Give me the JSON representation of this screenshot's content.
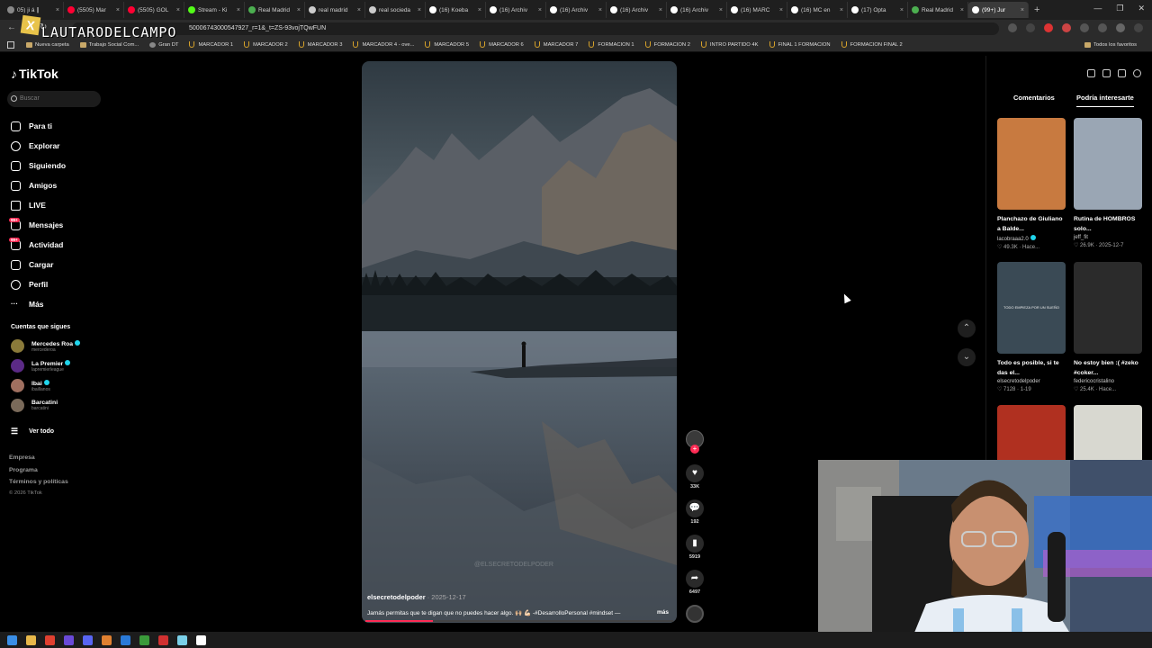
{
  "browser": {
    "tabs": [
      {
        "label": "05) ji á ∥",
        "color": "#888888"
      },
      {
        "label": "(5505) Mar",
        "color": "#ff0033"
      },
      {
        "label": "(5505) GOL",
        "color": "#ff0033"
      },
      {
        "label": "Stream - Ki",
        "color": "#53fc18"
      },
      {
        "label": "Real Madrid",
        "color": "#4caf50"
      },
      {
        "label": "real madrid",
        "color": "#cccccc"
      },
      {
        "label": "real socieda",
        "color": "#cccccc"
      },
      {
        "label": "(16) Koeba",
        "color": "#ffffff"
      },
      {
        "label": "(16) Archiv",
        "color": "#ffffff"
      },
      {
        "label": "(16) Archiv",
        "color": "#ffffff"
      },
      {
        "label": "(16) Archiv",
        "color": "#ffffff"
      },
      {
        "label": "(16) Archiv",
        "color": "#ffffff"
      },
      {
        "label": "(16) MARC",
        "color": "#ffffff"
      },
      {
        "label": "(16) MC en",
        "color": "#ffffff"
      },
      {
        "label": "(17) Opta",
        "color": "#ffffff"
      },
      {
        "label": "Real Madrid",
        "color": "#4caf50"
      },
      {
        "label": "(99+) Jur",
        "color": "#ffffff"
      }
    ],
    "active_tab_index": 16,
    "url": "50006743000547927_r=1&_t=ZS-93vojTQwFUN",
    "overlay_text": "LAUTARODELCAMPO",
    "bookmarks": [
      {
        "label": "Nueva carpeta",
        "kind": "folder"
      },
      {
        "label": "Trabajo Social Com...",
        "kind": "folder"
      },
      {
        "label": "Gran DT",
        "kind": "site"
      },
      {
        "label": "MARCADOR 1",
        "kind": "u"
      },
      {
        "label": "MARCADOR 2",
        "kind": "u"
      },
      {
        "label": "MARCADOR 3",
        "kind": "u"
      },
      {
        "label": "MARCADOR 4 - ove...",
        "kind": "u"
      },
      {
        "label": "MARCADOR 5",
        "kind": "u"
      },
      {
        "label": "MARCADOR 6",
        "kind": "u"
      },
      {
        "label": "MARCADOR 7",
        "kind": "u"
      },
      {
        "label": "FORMACION 1",
        "kind": "u"
      },
      {
        "label": "FORMACION 2",
        "kind": "u"
      },
      {
        "label": "INTRO PARTIDO 4K",
        "kind": "u"
      },
      {
        "label": "FINAL 1 FORMACION",
        "kind": "u"
      },
      {
        "label": "FORMACION FINAL 2",
        "kind": "u"
      }
    ],
    "bookmarks_right": "Todos los favoritos"
  },
  "tiktok": {
    "logo": "TikTok",
    "search_placeholder": "Buscar",
    "nav": [
      {
        "label": "Para ti",
        "icon": "home-icon"
      },
      {
        "label": "Explorar",
        "icon": "compass-icon"
      },
      {
        "label": "Siguiendo",
        "icon": "following-icon"
      },
      {
        "label": "Amigos",
        "icon": "friends-icon"
      },
      {
        "label": "LIVE",
        "icon": "live-icon"
      },
      {
        "label": "Mensajes",
        "icon": "messages-icon",
        "badge": "99+"
      },
      {
        "label": "Actividad",
        "icon": "activity-icon",
        "badge": "99+"
      },
      {
        "label": "Cargar",
        "icon": "upload-icon"
      },
      {
        "label": "Perfil",
        "icon": "profile-icon"
      },
      {
        "label": "Más",
        "icon": "more-icon"
      }
    ],
    "following_title": "Cuentas que sigues",
    "following": [
      {
        "name": "Mercedes Roa",
        "handle": "mercederoa",
        "verified": true,
        "color": "#8a7a3a"
      },
      {
        "name": "La Premier",
        "handle": "lapremierleague",
        "verified": true,
        "color": "#5b2a86"
      },
      {
        "name": "Ibai",
        "handle": "ibaillanos",
        "verified": true,
        "color": "#a07060"
      },
      {
        "name": "Barcatini",
        "handle": "barcatini",
        "verified": false,
        "color": "#7a6a5a"
      }
    ],
    "see_all": "Ver todo",
    "footer": [
      "Empresa",
      "Programa",
      "Términos y políticas"
    ],
    "copyright": "© 2026 TikTok"
  },
  "video": {
    "author": "elsecretodelpoder",
    "date": "2025-12-17",
    "caption": "Jamás permitas que te digan que no puedes hacer algo. 🙌🏼 💪🏻 -#DesarrolloPersonal #mindset —",
    "more": "más",
    "progress": 0.22,
    "watermark": "@ELSECRETODELPODER",
    "actions": {
      "likes": "33K",
      "comments": "192",
      "saves": "5919",
      "shares": "6497"
    }
  },
  "right_panel": {
    "tabs": [
      "Comentarios",
      "Podría interesarte"
    ],
    "selected_tab": 1,
    "cards": [
      {
        "title": "Planchazo de Giuliano a Balde...",
        "author": "lacobraaa2.0",
        "verified": true,
        "stats": "49.3K · Hace...",
        "bg": "#c87a40"
      },
      {
        "title": "Rutina de HOMBROS solo...",
        "author": "jeff_fit",
        "verified": false,
        "stats": "26.9K · 2025-12-7",
        "bg": "#9aa6b4"
      },
      {
        "title": "Todo es posible, si te das el...",
        "author": "elsecretodelpoder",
        "verified": false,
        "stats": "7128 · 1-19",
        "bg": "#3a4a55",
        "thumb_text": "TODO EMPIEZA POR UN SUEÑO"
      },
      {
        "title": "No estoy bien :( #zeko #coker...",
        "author": "federicocristalino",
        "verified": false,
        "stats": "25.4K · Hace...",
        "bg": "#2b2b2b"
      },
      {
        "title": "",
        "author": "",
        "verified": false,
        "stats": "",
        "bg": "#b03020"
      },
      {
        "title": "",
        "author": "",
        "verified": false,
        "stats": "",
        "bg": "#d8d8d0"
      }
    ]
  },
  "colors": {
    "accent": "#fe2c55",
    "verified": "#20d5ec",
    "bg": "#000000"
  }
}
